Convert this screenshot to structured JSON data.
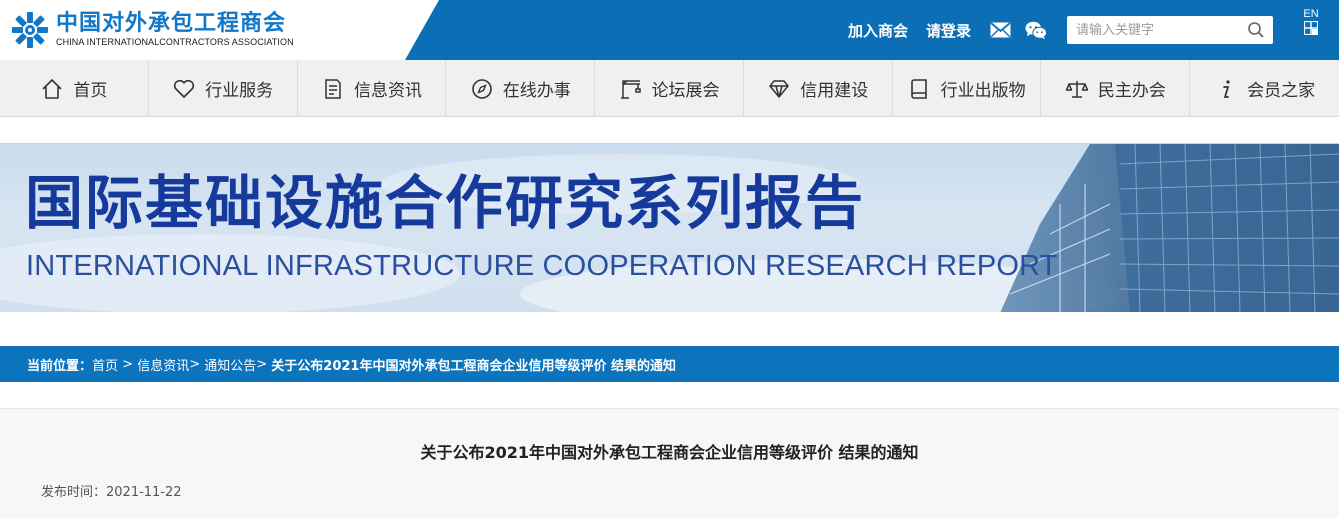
{
  "logo": {
    "cn": "中国对外承包工程商会",
    "en": "CHINA INTERNATIONALCONTRACTORS ASSOCIATION"
  },
  "header": {
    "join_label": "加入商会",
    "login_label": "请登录",
    "search_placeholder": "请输入关键字",
    "lang_label": "EN",
    "accent_color": "#0c6fb6"
  },
  "nav": {
    "items": [
      {
        "label": "首页",
        "icon": "home-icon"
      },
      {
        "label": "行业服务",
        "icon": "heart-icon"
      },
      {
        "label": "信息资讯",
        "icon": "document-icon"
      },
      {
        "label": "在线办事",
        "icon": "compass-icon"
      },
      {
        "label": "论坛展会",
        "icon": "crane-icon"
      },
      {
        "label": "信用建设",
        "icon": "diamond-icon"
      },
      {
        "label": "行业出版物",
        "icon": "book-icon"
      },
      {
        "label": "民主办会",
        "icon": "scales-icon"
      },
      {
        "label": "会员之家",
        "icon": "info-icon"
      }
    ]
  },
  "banner": {
    "title": "国际基础设施合作研究系列报告",
    "subtitle": "INTERNATIONAL INFRASTRUCTURE COOPERATION RESEARCH REPORT"
  },
  "breadcrumb": {
    "prefix": "当前位置：",
    "home": "首页",
    "sep1": " > ",
    "news": "信息资讯",
    "sep2": "> ",
    "notice": "通知公告",
    "sep3": "> ",
    "current": "关于公布2021年中国对外承包工程商会企业信用等级评价 结果的通知"
  },
  "article": {
    "title": "关于公布2021年中国对外承包工程商会企业信用等级评价 结果的通知",
    "publish_label": "发布时间：",
    "publish_date": "2021-11-22"
  }
}
